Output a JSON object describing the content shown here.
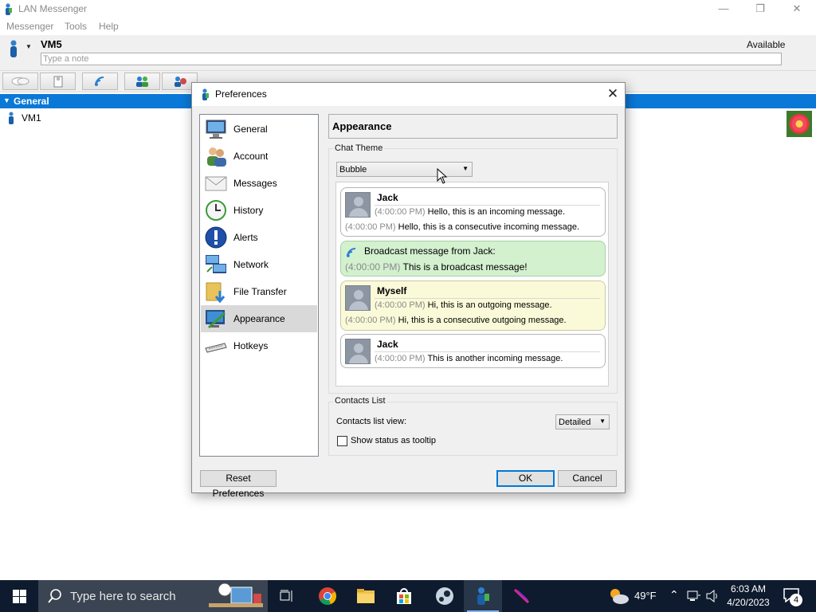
{
  "app": {
    "title": "LAN Messenger",
    "menu": [
      "Messenger",
      "Tools",
      "Help"
    ],
    "user_name": "VM5",
    "status": "Available",
    "note_placeholder": "Type a note"
  },
  "contacts": {
    "group_name": "General",
    "items": [
      {
        "name": "VM1"
      }
    ]
  },
  "dialog": {
    "title": "Preferences",
    "categories": [
      {
        "label": "General",
        "icon": "monitor-icon"
      },
      {
        "label": "Account",
        "icon": "users-icon"
      },
      {
        "label": "Messages",
        "icon": "envelope-icon"
      },
      {
        "label": "History",
        "icon": "clock-history-icon"
      },
      {
        "label": "Alerts",
        "icon": "alert-icon"
      },
      {
        "label": "Network",
        "icon": "network-icon"
      },
      {
        "label": "File Transfer",
        "icon": "folder-icon"
      },
      {
        "label": "Appearance",
        "icon": "appearance-icon"
      },
      {
        "label": "Hotkeys",
        "icon": "keyboard-icon"
      }
    ],
    "selected_category": "Appearance",
    "page_title": "Appearance",
    "chat_theme": {
      "group_title": "Chat Theme",
      "selected": "Bubble"
    },
    "preview": {
      "incoming": {
        "sender": "Jack",
        "time": "(4:00:00 PM)",
        "msg1": "Hello, this is an incoming message.",
        "msg2": "Hello, this is a consecutive incoming message."
      },
      "broadcast": {
        "title": "Broadcast message from Jack:",
        "time": "(4:00:00 PM)",
        "msg": "This is a broadcast message!"
      },
      "outgoing": {
        "sender": "Myself",
        "time": "(4:00:00 PM)",
        "msg1": "Hi, this is an outgoing message.",
        "msg2": "Hi, this is a consecutive outgoing message."
      },
      "incoming2": {
        "sender": "Jack",
        "time": "(4:00:00 PM)",
        "msg": "This is another incoming message."
      }
    },
    "contacts_list": {
      "group_title": "Contacts List",
      "view_label": "Contacts list view:",
      "view_value": "Detailed",
      "tooltip_label": "Show status as tooltip",
      "tooltip_checked": false
    },
    "buttons": {
      "reset": "Reset Preferences",
      "ok": "OK",
      "cancel": "Cancel"
    }
  },
  "taskbar": {
    "search_placeholder": "Type here to search",
    "weather": "49°F",
    "time": "6:03 AM",
    "date": "4/20/2023",
    "notification_count": "4"
  },
  "colors": {
    "accent": "#0a78d7",
    "broadcast_bg": "#d3f0cf",
    "outgoing_bg": "#fafad8",
    "taskbar_bg": "#0e1b2e"
  }
}
